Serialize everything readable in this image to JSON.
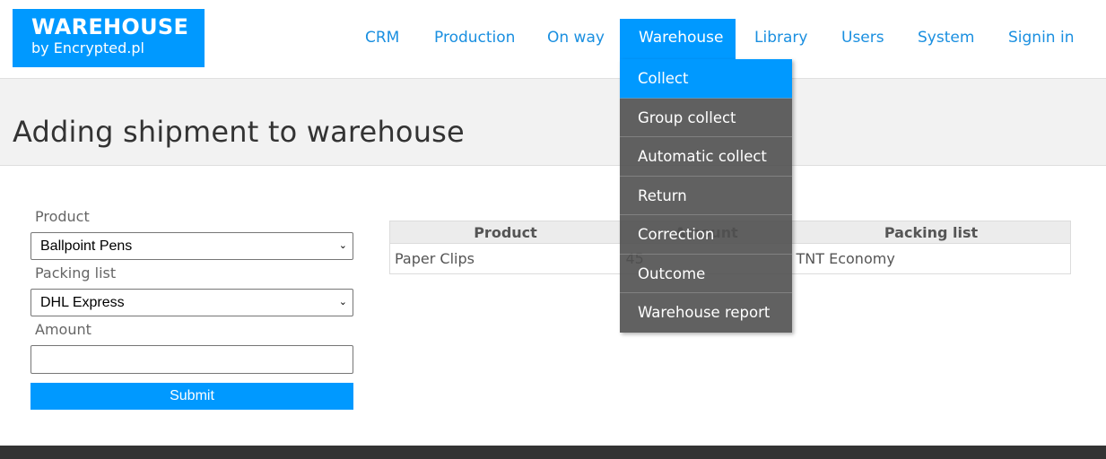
{
  "logo": {
    "title": "WAREHOUSE",
    "subtitle": "by Encrypted.pl"
  },
  "nav": {
    "items": [
      {
        "label": "CRM"
      },
      {
        "label": "Production"
      },
      {
        "label": "On way"
      },
      {
        "label": "Warehouse",
        "active": true
      },
      {
        "label": "Library"
      },
      {
        "label": "Users"
      },
      {
        "label": "System"
      },
      {
        "label": "Signin in"
      }
    ]
  },
  "dropdown": {
    "items": [
      {
        "label": "Collect",
        "active": true
      },
      {
        "label": "Group collect"
      },
      {
        "label": "Automatic collect"
      },
      {
        "label": "Return"
      },
      {
        "label": "Correction"
      },
      {
        "label": "Outcome"
      },
      {
        "label": "Warehouse report"
      }
    ]
  },
  "page": {
    "title": "Adding shipment to warehouse"
  },
  "form": {
    "product_label": "Product",
    "product_value": "Ballpoint Pens",
    "packing_label": "Packing list",
    "packing_value": "DHL Express",
    "amount_label": "Amount",
    "amount_value": "",
    "submit_label": "Submit",
    "chevron": "❯"
  },
  "table": {
    "headers": [
      "Product",
      "Amount",
      "Packing list"
    ],
    "rows": [
      [
        "Paper Clips",
        "45",
        "TNT Economy"
      ]
    ]
  },
  "colors": {
    "accent": "#0099ff",
    "menu_bg": "#505050",
    "footer": "#333333"
  }
}
